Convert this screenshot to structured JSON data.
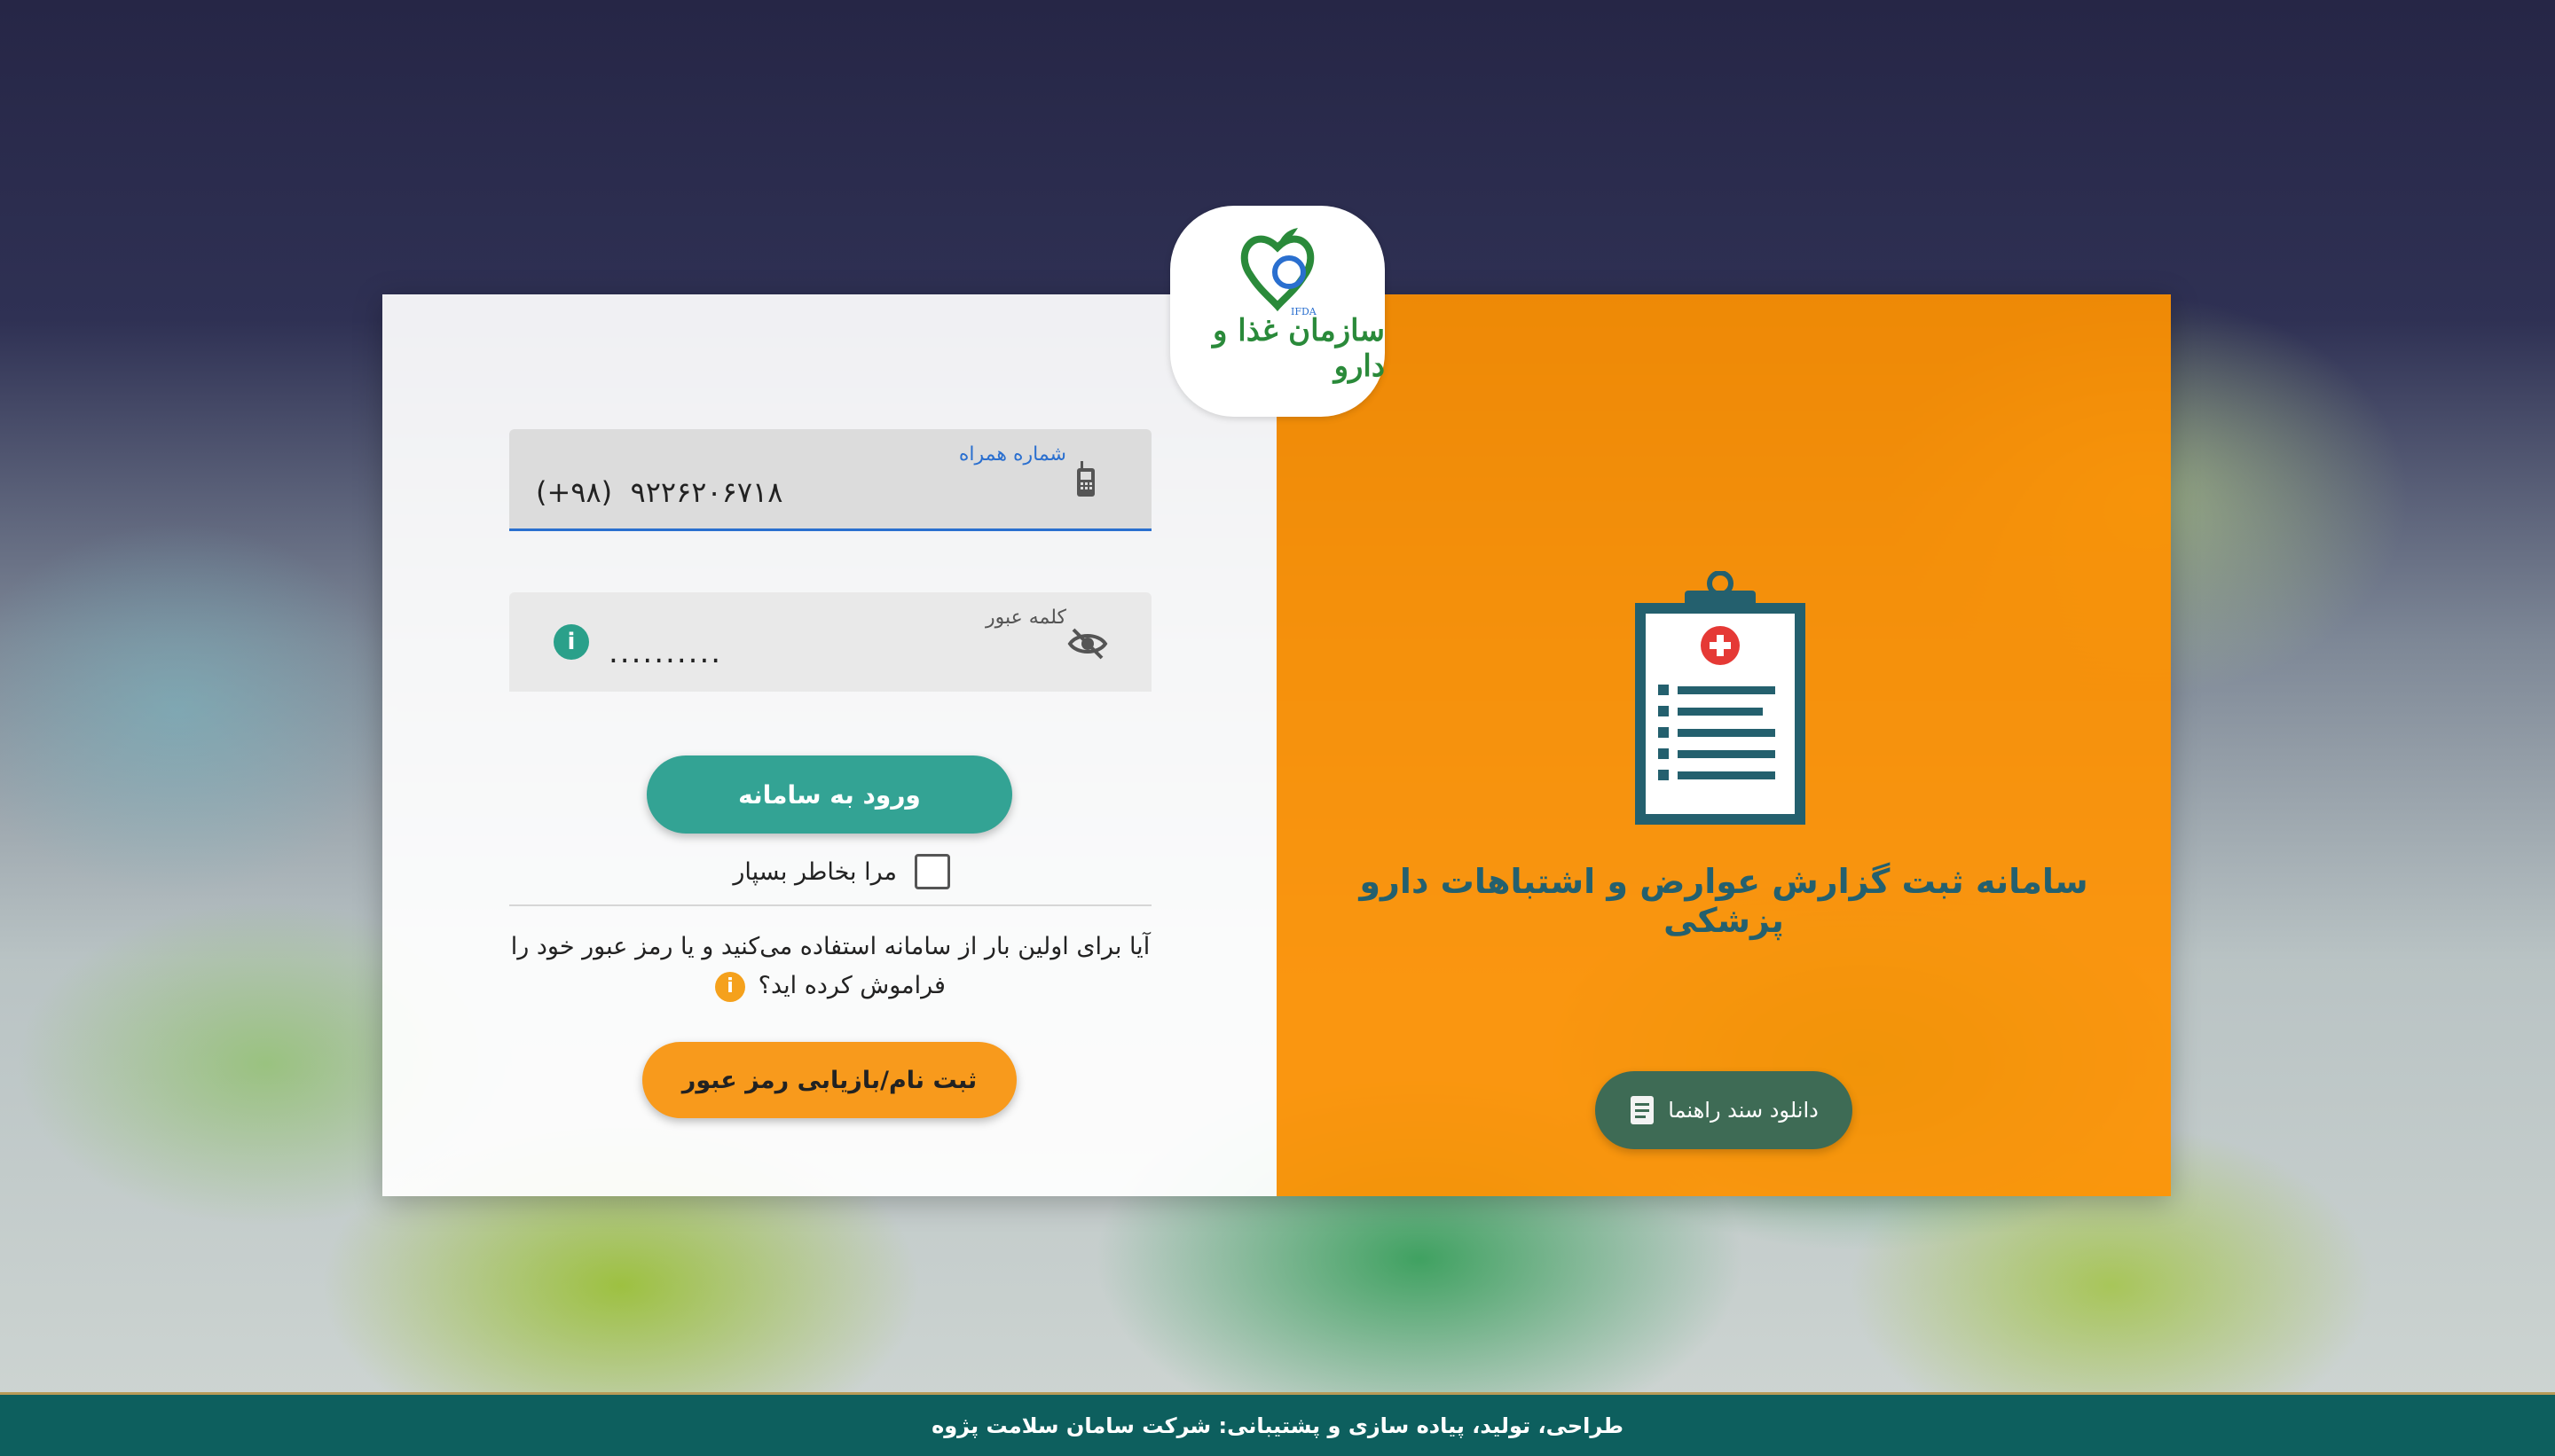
{
  "logo": {
    "org_name": "سازمان غذا و دارو",
    "abbr": "IFDA",
    "icon": "ifda-logo"
  },
  "login_form": {
    "phone_field": {
      "label": "شماره همراه",
      "value": "(+۹۸)  ۹۲۲۶۲۰۶۷۱۸",
      "icon": "mobile-phone-icon"
    },
    "password_field": {
      "label": "کلمه عبور",
      "value": "..........",
      "visibility_icon": "eye-off-icon",
      "info_icon": "info-icon",
      "info_glyph": "i"
    },
    "login_button": "ورود به سامانه",
    "remember_me": {
      "label": "مرا بخاطر بسپار",
      "checked": false
    },
    "first_time_text": "آیا برای اولین بار از سامانه استفاده می‌کنید و یا رمز عبور خود را فراموش کرده اید؟",
    "first_time_info_glyph": "i",
    "register_button": "ثبت نام/بازیابی رمز عبور"
  },
  "info_panel": {
    "icon": "medical-clipboard-icon",
    "title": "سامانه ثبت گزارش عوارض و اشتباهات دارو پزشکی",
    "download_button": "دانلود سند راهنما",
    "download_icon": "document-icon"
  },
  "footer": {
    "text": "طراحی، تولید، پیاده سازی و پشتیبانی: شرکت سامان سلامت پژوه"
  },
  "colors": {
    "panel_orange": "#ff9100",
    "login_teal": "#33a394",
    "register_orange": "#f89a1c",
    "title_teal": "#24606e",
    "footer_teal": "#0d5f5e",
    "download_green": "#3e6b55",
    "focus_blue": "#2a6fcf"
  }
}
